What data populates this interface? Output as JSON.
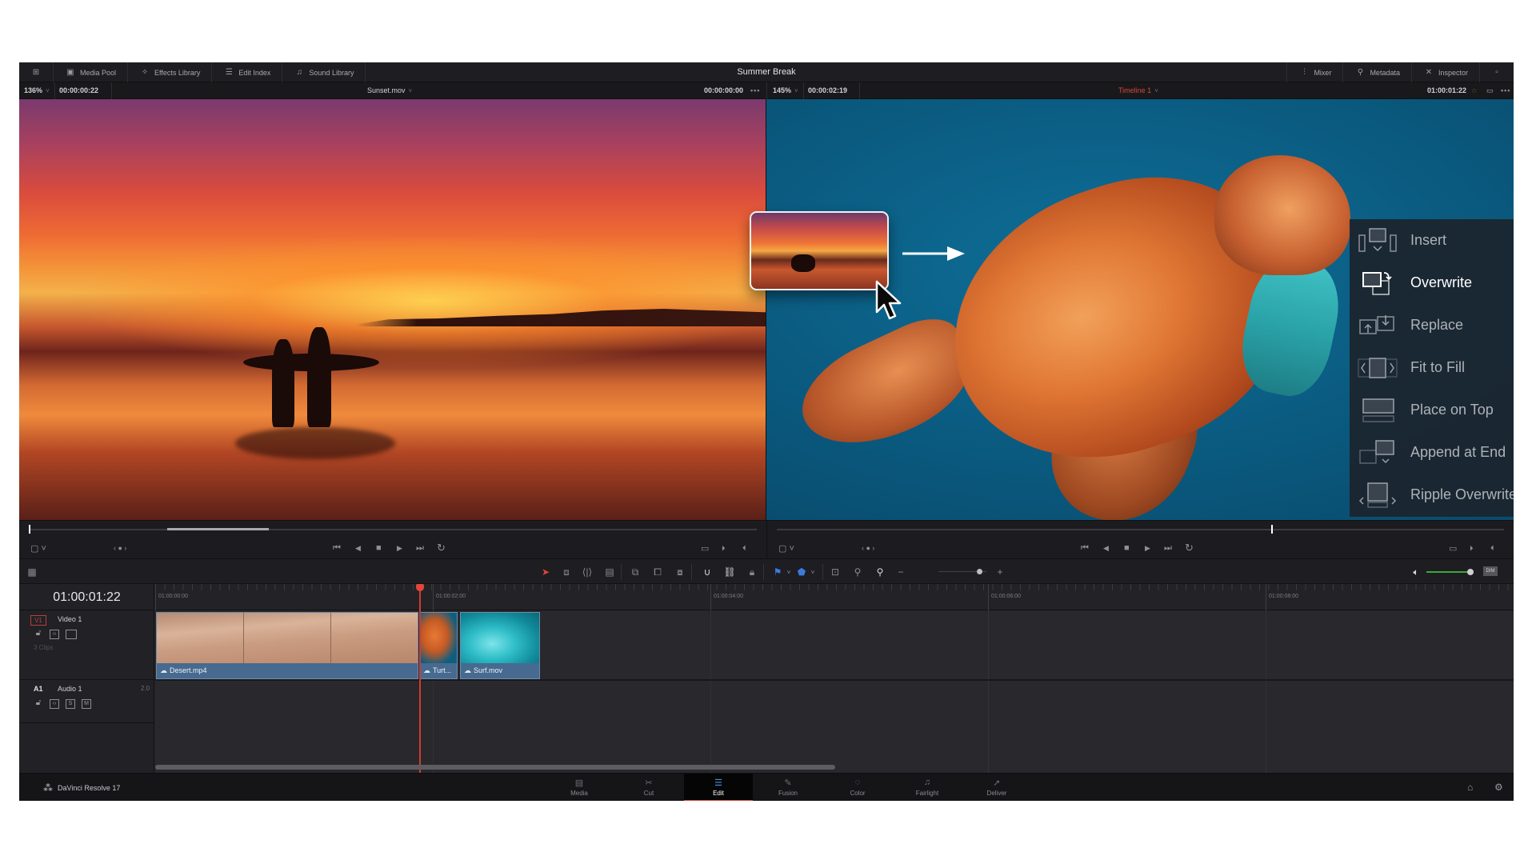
{
  "app": {
    "project_title": "Summer Break",
    "brand": "DaVinci Resolve 17"
  },
  "topbar": {
    "left": [
      {
        "id": "workspace",
        "label": "",
        "icon": "workspace-icon"
      },
      {
        "id": "media_pool",
        "label": "Media Pool",
        "icon": "media-pool-icon"
      },
      {
        "id": "effects_library",
        "label": "Effects Library",
        "icon": "effects-wand-icon"
      },
      {
        "id": "edit_index",
        "label": "Edit Index",
        "icon": "list-icon"
      },
      {
        "id": "sound_library",
        "label": "Sound Library",
        "icon": "music-note-icon"
      }
    ],
    "right": [
      {
        "id": "mixer",
        "label": "Mixer",
        "icon": "mixer-icon"
      },
      {
        "id": "metadata",
        "label": "Metadata",
        "icon": "metadata-icon"
      },
      {
        "id": "inspector",
        "label": "Inspector",
        "icon": "inspector-icon"
      }
    ]
  },
  "source_viewer": {
    "zoom": "136%",
    "duration": "00:00:00:22",
    "clip_name": "Sunset.mov",
    "timecode": "00:00:00:00",
    "more": "•••"
  },
  "timeline_viewer": {
    "zoom": "145%",
    "duration": "00:00:02:19",
    "timeline_name": "Timeline 1",
    "timecode": "01:00:01:22",
    "more": "•••"
  },
  "edit_overlay": {
    "items": [
      {
        "label": "Insert",
        "icon": "insert-icon",
        "active": false
      },
      {
        "label": "Overwrite",
        "icon": "overwrite-icon",
        "active": true
      },
      {
        "label": "Replace",
        "icon": "replace-icon",
        "active": false
      },
      {
        "label": "Fit to Fill",
        "icon": "fit-to-fill-icon",
        "active": false
      },
      {
        "label": "Place on Top",
        "icon": "place-on-top-icon",
        "active": false
      },
      {
        "label": "Append at End",
        "icon": "append-at-end-icon",
        "active": false
      },
      {
        "label": "Ripple Overwrite",
        "icon": "ripple-overwrite-icon",
        "active": false
      }
    ]
  },
  "source_transport": {
    "playhead_fraction": 0.0,
    "mark_in_fraction": 0.19,
    "mark_out_fraction": 0.33
  },
  "timeline_transport": {
    "playhead_fraction": 0.68
  },
  "icons": {
    "jog": "‹ ● ›",
    "go_start": "⏮",
    "step_back": "◀",
    "stop": "■",
    "play": "▶",
    "go_end": "⏭",
    "loop": "↻",
    "match_frame": "▭",
    "mark_in": "⏵",
    "mark_out": "⏴",
    "view_options": "▢ ˅"
  },
  "timeline": {
    "current_timecode": "01:00:01:22",
    "ruler_labels": [
      "01:00:00:00",
      "01:00:02:00",
      "01:00:04:00",
      "01:00:06:00",
      "01:00:08:00"
    ],
    "tracks": {
      "video": {
        "badge": "V1",
        "name": "Video 1",
        "clips_count": "3 Clips"
      },
      "audio": {
        "badge": "A1",
        "name": "Audio 1",
        "channels": "2.0",
        "solo": "S",
        "mute": "M"
      }
    },
    "clips": [
      {
        "name": "Desert.mp4"
      },
      {
        "name": "Turt..."
      },
      {
        "name": "Surf.mov"
      }
    ],
    "audio_level_fraction": 0.95,
    "zoom_fraction": 0.85,
    "dim_label": "DIM"
  },
  "pages": [
    {
      "label": "Media",
      "icon": "▤"
    },
    {
      "label": "Cut",
      "icon": "✂"
    },
    {
      "label": "Edit",
      "icon": "☰",
      "active": true
    },
    {
      "label": "Fusion",
      "icon": "✎"
    },
    {
      "label": "Color",
      "icon": "◌"
    },
    {
      "label": "Fairlight",
      "icon": "♫"
    },
    {
      "label": "Deliver",
      "icon": "➚"
    }
  ],
  "colors": {
    "accent_red": "#d9463c",
    "clip_blue": "#476a90",
    "volume_green": "#3aa83a"
  }
}
